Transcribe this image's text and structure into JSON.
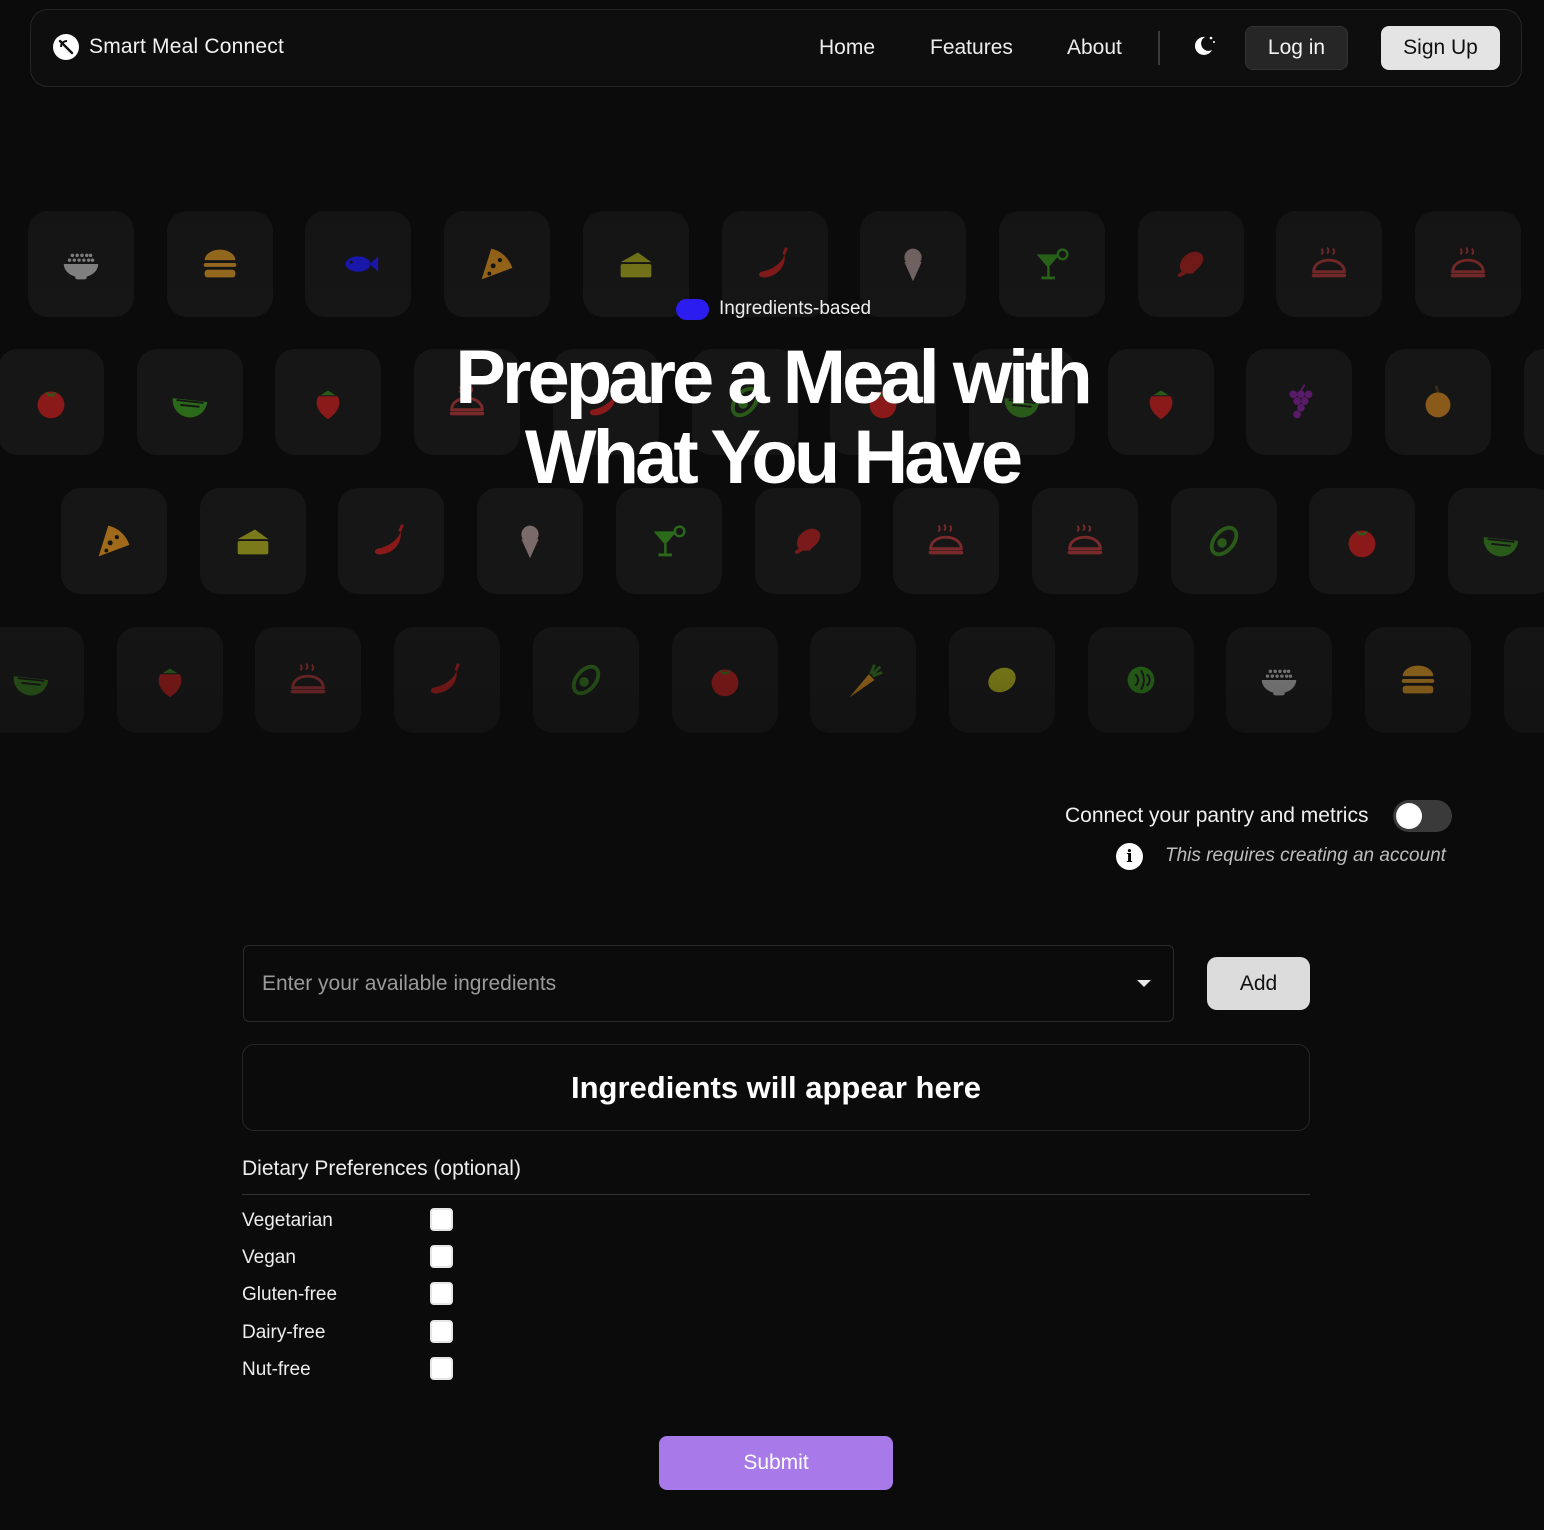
{
  "nav": {
    "brand": "Smart Meal Connect",
    "links": [
      "Home",
      "Features",
      "About"
    ],
    "login": "Log in",
    "signup": "Sign Up"
  },
  "hero": {
    "badge": "Ingredients-based",
    "title_line1": "Prepare a Meal with",
    "title_line2": "What You Have"
  },
  "food_icons": {
    "row1": [
      [
        "rice-bowl",
        "#8a8a8a"
      ],
      [
        "burger",
        "#a0701f"
      ],
      [
        "fish",
        "#1a18b8"
      ],
      [
        "pizza",
        "#a06a1a"
      ],
      [
        "cake",
        "#7a7a1a"
      ],
      [
        "chili",
        "#8a1a1a"
      ],
      [
        "ice-cream",
        "#7a6a6a"
      ],
      [
        "cocktail",
        "#2a6a1a"
      ],
      [
        "meat",
        "#7a1a1a"
      ],
      [
        "roast",
        "#7a2a2a"
      ],
      [
        "roast",
        "#7a2a2a"
      ]
    ],
    "row2": [
      [
        "tomato",
        "#8a1a1a"
      ],
      [
        "watermelon",
        "#2a6a1a"
      ],
      [
        "strawberry",
        "#8a1a1a"
      ],
      [
        "roast",
        "#7a2a2a"
      ],
      [
        "chili",
        "#8a1a1a"
      ],
      [
        "avocado",
        "#2a5a1a"
      ],
      [
        "tomato",
        "#8a1a1a"
      ],
      [
        "watermelon",
        "#2a5a1a"
      ],
      [
        "strawberry",
        "#8a1a1a"
      ],
      [
        "grapes",
        "#5a1a6a"
      ],
      [
        "peach",
        "#8a5a1a"
      ],
      [
        "tomato",
        "#8a1a1a"
      ]
    ],
    "row3": [
      [
        "pizza",
        "#a06a1a"
      ],
      [
        "cake",
        "#7a7a1a"
      ],
      [
        "chili",
        "#8a1a1a"
      ],
      [
        "ice-cream",
        "#7a6a6a"
      ],
      [
        "cocktail",
        "#2a6a1a"
      ],
      [
        "meat",
        "#7a1a1a"
      ],
      [
        "roast",
        "#7a2a2a"
      ],
      [
        "roast",
        "#7a2a2a"
      ],
      [
        "avocado",
        "#2a5a1a"
      ],
      [
        "tomato",
        "#8a1a1a"
      ],
      [
        "watermelon",
        "#2a5a1a"
      ]
    ],
    "row4": [
      [
        "watermelon",
        "#2a5a1a"
      ],
      [
        "strawberry",
        "#8a1a1a"
      ],
      [
        "roast",
        "#7a2a2a"
      ],
      [
        "chili",
        "#8a1a1a"
      ],
      [
        "avocado",
        "#2a5a1a"
      ],
      [
        "tomato",
        "#8a1a1a"
      ],
      [
        "carrot",
        "#a06a1a"
      ],
      [
        "lemon",
        "#8a8a1a"
      ],
      [
        "cabbage",
        "#2a6a1a"
      ],
      [
        "rice-bowl",
        "#8a8a8a"
      ],
      [
        "burger",
        "#a0701f"
      ],
      [
        "fish",
        "#1a18b8"
      ]
    ]
  },
  "connect": {
    "label": "Connect your pantry and metrics",
    "enabled": false,
    "note": "This requires creating an account"
  },
  "ingredients": {
    "placeholder": "Enter your available ingredients",
    "add": "Add",
    "empty_message": "Ingredients will appear here"
  },
  "dietary": {
    "title": "Dietary Preferences (optional)",
    "options": [
      "Vegetarian",
      "Vegan",
      "Gluten-free",
      "Dairy-free",
      "Nut-free"
    ]
  },
  "submit": "Submit",
  "colors": {
    "accent": "#a779e9",
    "badge": "#2b1df0",
    "background": "#0b0b0b"
  }
}
